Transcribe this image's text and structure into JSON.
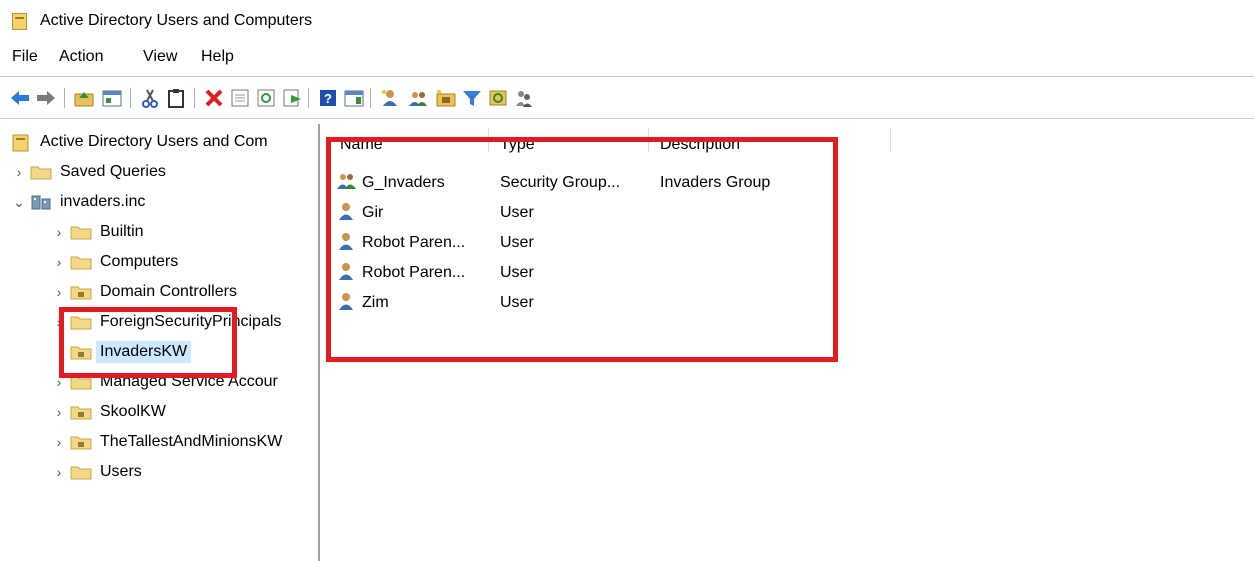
{
  "window": {
    "title": "Active Directory Users and Computers"
  },
  "menu": [
    "File",
    "Action",
    "View",
    "Help"
  ],
  "toolbar": {
    "icons": [
      "back-arrow-icon",
      "forward-arrow-icon",
      "up-folder-icon",
      "show-hide-tree-icon",
      "cut-icon",
      "paste-icon",
      "delete-icon",
      "properties-icon",
      "refresh-icon",
      "export-icon",
      "help-icon",
      "show-action-pane-icon",
      "new-user-icon",
      "new-group-icon",
      "new-ou-icon",
      "filter-icon",
      "find-icon",
      "delegate-icon"
    ]
  },
  "tree": {
    "root": "Active Directory Users and Com",
    "saved_queries": "Saved Queries",
    "domain": "invaders.inc",
    "children": [
      "Builtin",
      "Computers",
      "Domain Controllers",
      "ForeignSecurityPrincipals",
      "InvadersKW",
      "Managed Service Accour",
      "SkoolKW",
      "TheTallestAndMinionsKW",
      "Users"
    ],
    "selected": "InvadersKW"
  },
  "list": {
    "columns": {
      "name": "Name",
      "type": "Type",
      "description": "Description"
    },
    "rows": [
      {
        "name": "G_Invaders",
        "type": "Security Group...",
        "description": "Invaders Group",
        "icon": "group-icon"
      },
      {
        "name": "Gir",
        "type": "User",
        "description": "",
        "icon": "user-icon"
      },
      {
        "name": "Robot Paren...",
        "type": "User",
        "description": "",
        "icon": "user-icon"
      },
      {
        "name": "Robot Paren...",
        "type": "User",
        "description": "",
        "icon": "user-icon"
      },
      {
        "name": "Zim",
        "type": "User",
        "description": "",
        "icon": "user-icon"
      }
    ]
  },
  "colors": {
    "highlight": "#e31b23",
    "selection": "#cce8ff"
  }
}
